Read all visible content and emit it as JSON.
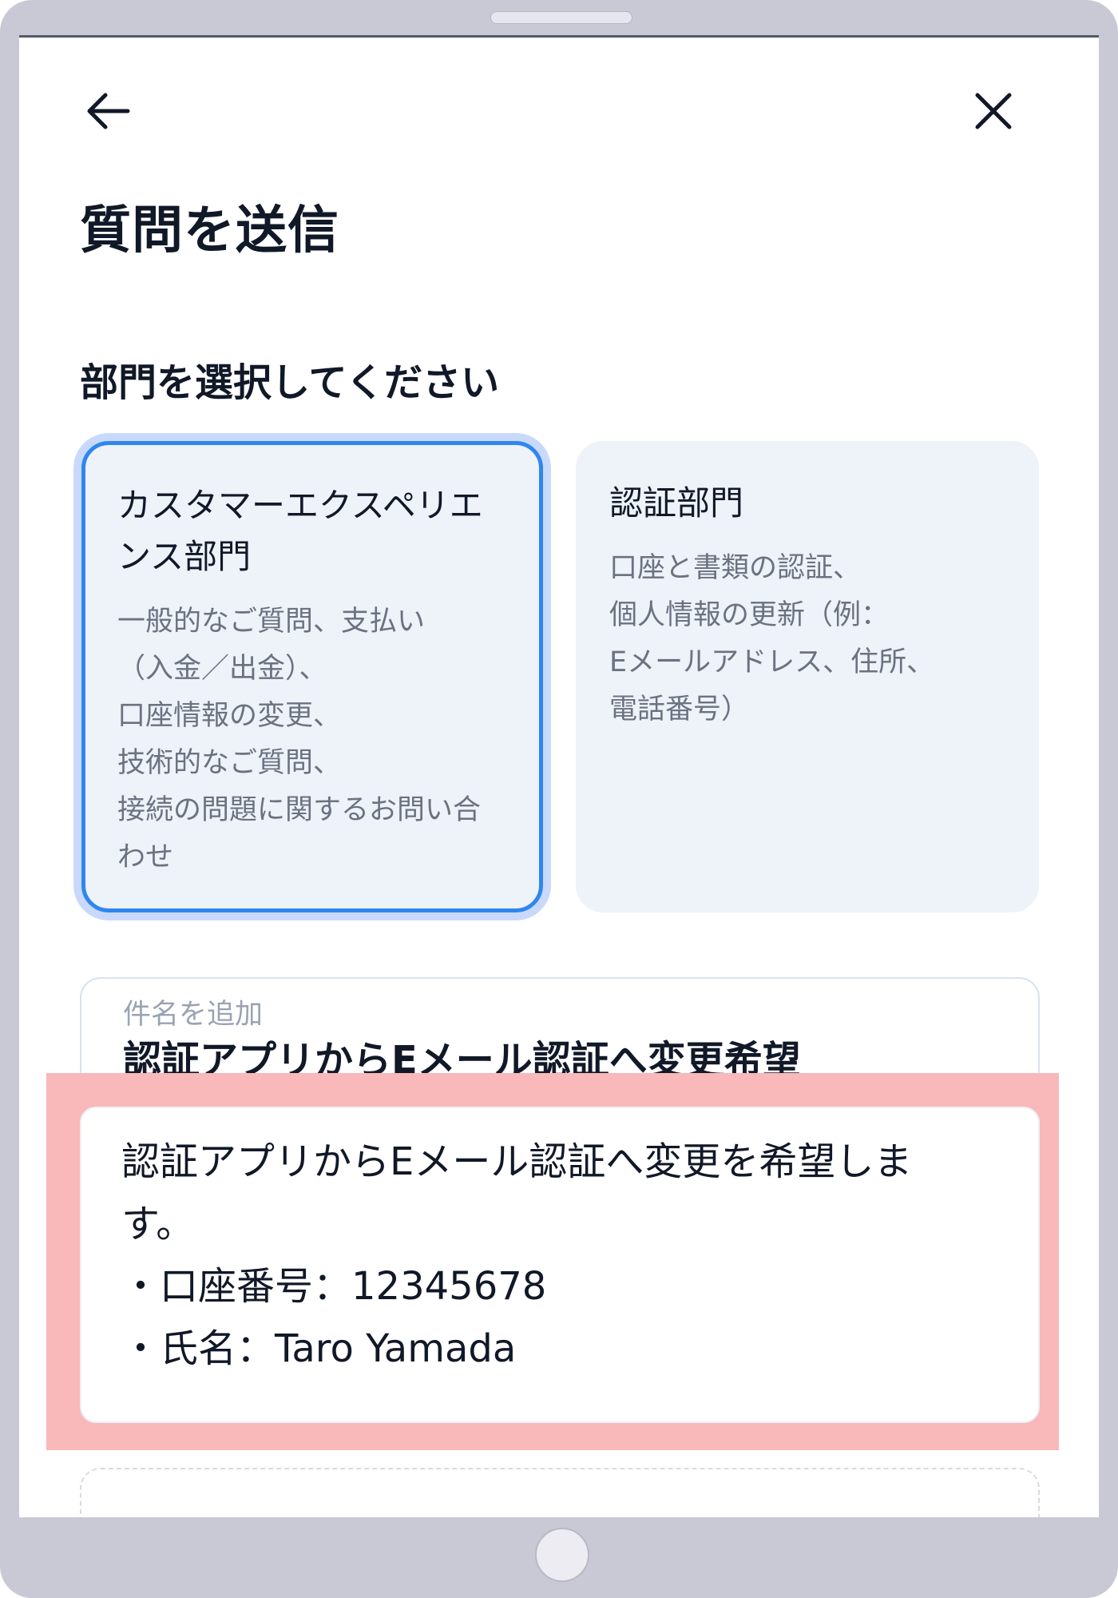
{
  "header": {
    "back_icon": "arrow-left-icon",
    "close_icon": "close-icon",
    "title": "質問を送信"
  },
  "department": {
    "prompt": "部門を選択してください",
    "options": [
      {
        "title": "カスタマーエクスペリエンス部門",
        "description": "一般的なご質問、支払い\n（入金／出金）、\n口座情報の変更、\n技術的なご質問、\n接続の問題に関するお問い合わせ",
        "selected": true
      },
      {
        "title": "認証部門",
        "description": "口座と書類の認証、\n個人情報の更新（例：\nEメールアドレス、住所、\n電話番号）",
        "selected": false
      }
    ]
  },
  "subject": {
    "placeholder": "件名を追加",
    "value": "認証アプリからEメール認証へ変更希望"
  },
  "message": {
    "lines": [
      "認証アプリからEメール認証へ変更を希望しま",
      "す。",
      "・口座番号：12345678",
      "・氏名：Taro Yamada"
    ]
  },
  "colors": {
    "selected_border": "#2f86ef",
    "selected_glow": "#c8d9fb",
    "card_bg": "#eef2f9",
    "highlight": "#f9b8ba"
  }
}
